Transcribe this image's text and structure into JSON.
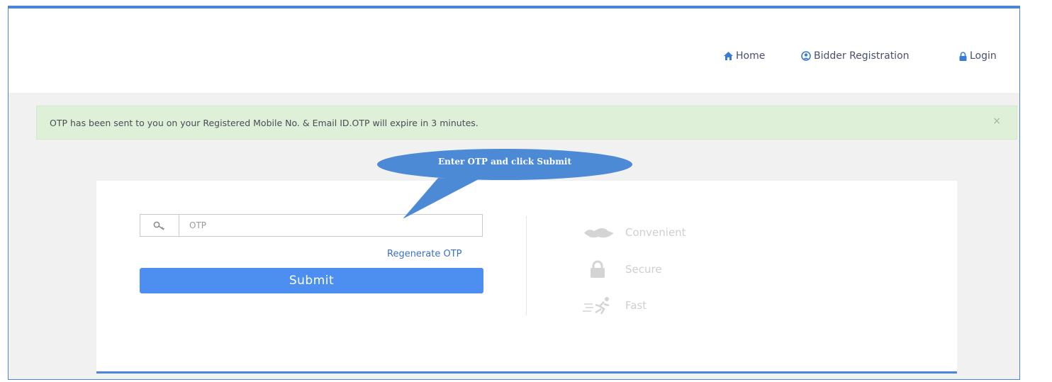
{
  "nav": {
    "home": "Home",
    "bidder_registration": "Bidder Registration",
    "login": "Login"
  },
  "alert": {
    "message": "OTP has been sent to you on your Registered Mobile No. & Email ID.OTP will expire in 3 minutes.",
    "close": "×"
  },
  "callout": {
    "text": "Enter OTP and click Submit"
  },
  "form": {
    "otp_placeholder": "OTP",
    "otp_value": "",
    "regenerate_label": "Regenerate OTP",
    "submit_label": "Submit"
  },
  "features": [
    {
      "label": "Convenient",
      "icon": "handshake-icon"
    },
    {
      "label": "Secure",
      "icon": "lock-icon"
    },
    {
      "label": "Fast",
      "icon": "runner-icon"
    }
  ],
  "colors": {
    "accent": "#4a86d8",
    "button": "#4d8ff0",
    "alert_bg": "#dff0d8",
    "callout": "#4c8ad6"
  }
}
